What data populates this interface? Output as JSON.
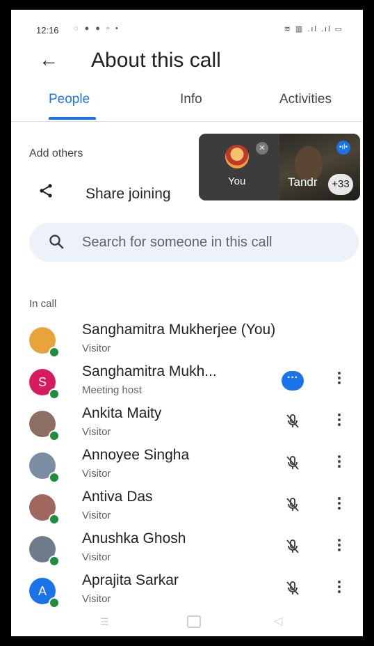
{
  "status_bar": {
    "time": "12:16",
    "left_icons": "◌ ● ● ▫ •",
    "right_icons": "≋ ▥ .ıl .ıl ▭"
  },
  "app_bar": {
    "title": "About this call"
  },
  "tabs": [
    {
      "label": "People",
      "active": true
    },
    {
      "label": "Info",
      "active": false
    },
    {
      "label": "Activities",
      "active": false
    }
  ],
  "add_others": {
    "label": "Add others",
    "share_text": "Share joining"
  },
  "pip": {
    "you_label": "You",
    "other_name": "Tandr",
    "more_count": "+33"
  },
  "search": {
    "placeholder": "Search for someone in this call"
  },
  "in_call": {
    "heading": "In call",
    "participants": [
      {
        "name": "Sanghamitra Mukherjee (You)",
        "role": "Visitor",
        "avatar_text": "",
        "avatar_color": "#e8a33a",
        "action": "none"
      },
      {
        "name": "Sanghamitra Mukh...",
        "role": "Meeting host",
        "avatar_text": "S",
        "avatar_color": "#d81b60",
        "action": "more-button"
      },
      {
        "name": "Ankita Maity",
        "role": "Visitor",
        "avatar_text": "",
        "avatar_color": "#8d6e63",
        "action": "mic-off"
      },
      {
        "name": "Annoyee Singha",
        "role": "Visitor",
        "avatar_text": "",
        "avatar_color": "#7b8da0",
        "action": "mic-off"
      },
      {
        "name": "Antiva Das",
        "role": "Visitor",
        "avatar_text": "",
        "avatar_color": "#a1665e",
        "action": "mic-off"
      },
      {
        "name": "Anushka Ghosh",
        "role": "Visitor",
        "avatar_text": "",
        "avatar_color": "#6d7b8c",
        "action": "mic-off"
      },
      {
        "name": "Aprajita Sarkar",
        "role": "Visitor",
        "avatar_text": "A",
        "avatar_color": "#1a73e8",
        "action": "mic-off"
      }
    ]
  },
  "icons": {
    "back": "arrow-back-icon",
    "share": "share-icon",
    "search": "search-icon",
    "mic_off": "mic-off-icon",
    "kebab": "more-vert-icon"
  },
  "colors": {
    "accent": "#1a73e8",
    "online": "#1e8e3e",
    "search_bg": "#edf2f8"
  }
}
